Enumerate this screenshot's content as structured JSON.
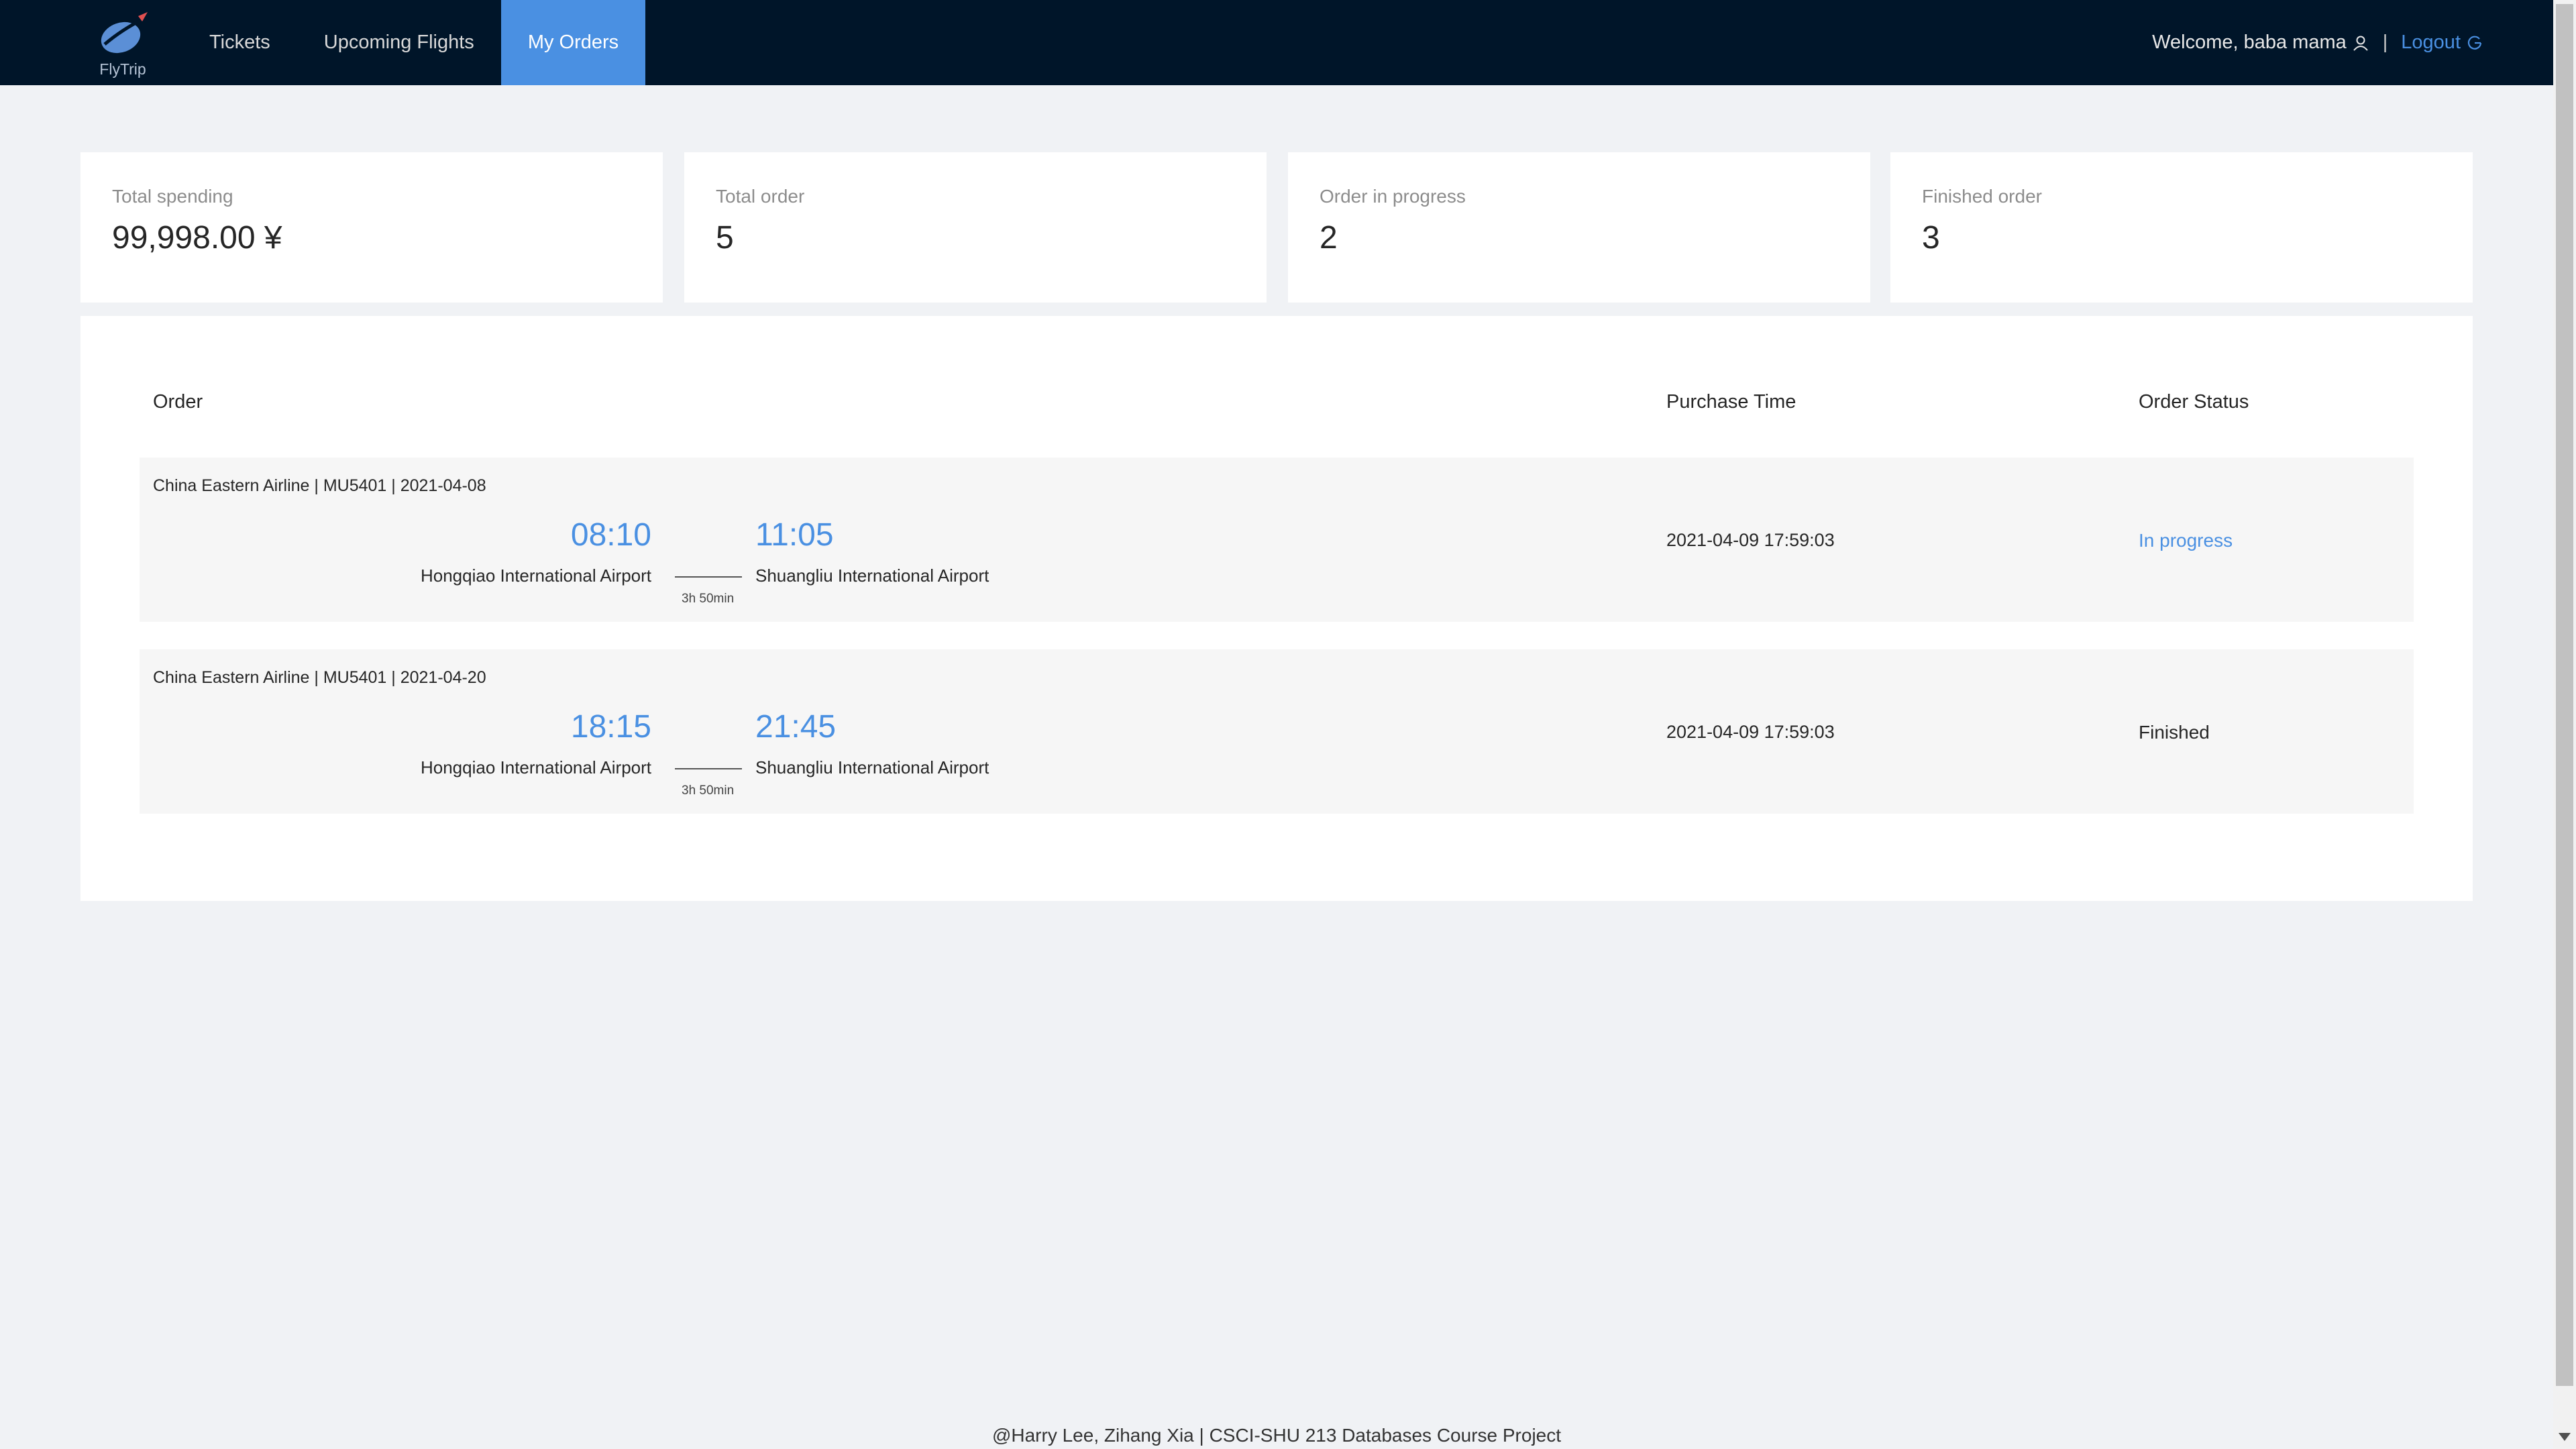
{
  "header": {
    "logo_text": "FlyTrip",
    "nav": [
      {
        "label": "Tickets",
        "active": false
      },
      {
        "label": "Upcoming Flights",
        "active": false
      },
      {
        "label": "My Orders",
        "active": true
      }
    ],
    "welcome": "Welcome, baba mama",
    "separator": "|",
    "logout": "Logout"
  },
  "stats": [
    {
      "title": "Total spending",
      "value": "99,998.00 ¥"
    },
    {
      "title": "Total order",
      "value": "5"
    },
    {
      "title": "Order in progress",
      "value": "2"
    },
    {
      "title": "Finished order",
      "value": "3"
    }
  ],
  "table": {
    "columns": {
      "order": "Order",
      "purchase_time": "Purchase Time",
      "status": "Order Status"
    },
    "rows": [
      {
        "meta": "China Eastern Airline | MU5401 | 2021-04-08",
        "depart_time": "08:10",
        "arrive_time": "11:05",
        "depart_airport": "Hongqiao International Airport",
        "arrive_airport": "Shuangliu International Airport",
        "duration": "3h 50min",
        "purchase_time": "2021-04-09 17:59:03",
        "status": "In progress"
      },
      {
        "meta": "China Eastern Airline | MU5401 | 2021-04-20",
        "depart_time": "18:15",
        "arrive_time": "21:45",
        "depart_airport": "Hongqiao International Airport",
        "arrive_airport": "Shuangliu International Airport",
        "duration": "3h 50min",
        "purchase_time": "2021-04-09 17:59:03",
        "status": "Finished"
      }
    ]
  },
  "footer": "@Harry Lee, Zihang Xia | CSCI-SHU 213 Databases Course Project",
  "colors": {
    "header_bg": "#001529",
    "accent": "#4a90e2",
    "page_bg": "#f0f2f5"
  }
}
